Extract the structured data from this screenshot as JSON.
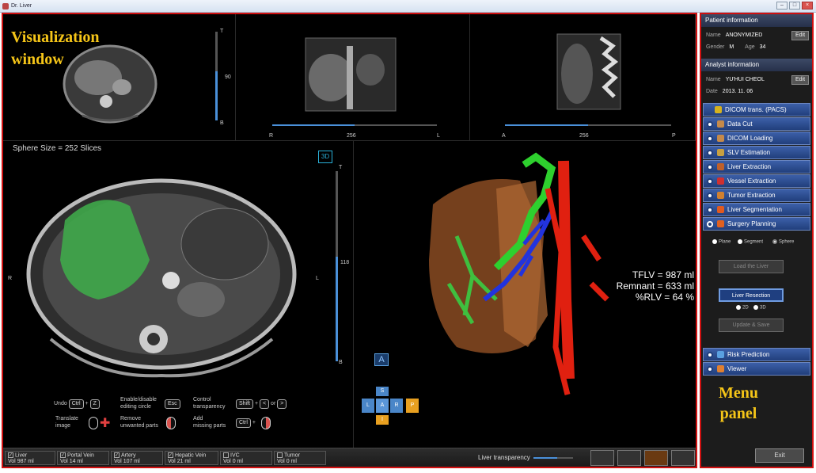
{
  "window": {
    "title": "Dr. Liver"
  },
  "overlay": {
    "viz_title_line1": "Visualization",
    "viz_title_line2": "window",
    "menu_title_line1": "Menu",
    "menu_title_line2": "panel"
  },
  "axial_small": {
    "top": "T",
    "bottom": "B",
    "value": "90"
  },
  "coronal": {
    "left": "R",
    "right": "L",
    "value": "256"
  },
  "sagittal": {
    "left": "A",
    "right": "P",
    "value": "256"
  },
  "main_axial": {
    "sphere_size": "Sphere Size = 252 Slices",
    "left": "R",
    "right": "L",
    "top": "T",
    "bottom": "B",
    "value": "118",
    "badge_3d": "3D"
  },
  "stats": {
    "tflv": "TFLV = 987 ml",
    "remnant": "Remnant = 633 ml",
    "rlv": "%RLV = 64 %"
  },
  "orientation": {
    "a_top": "A",
    "s": "S",
    "l": "L",
    "a": "A",
    "r": "R",
    "p": "P",
    "i": "I"
  },
  "hints": {
    "undo": "Undo",
    "undo_key1": "Ctrl",
    "undo_key2": "Z",
    "translate": "Translate\nimage",
    "enable": "Enable/disable\nediting circle",
    "enable_key": "Esc",
    "remove": "Remove\nunwanted parts",
    "control": "Control\ntransparency",
    "control_key1": "Shift",
    "control_key2": "<",
    "control_or": "or",
    "control_key3": ">",
    "add": "Add\nmissing parts",
    "add_key": "Ctrl"
  },
  "structures": [
    {
      "name": "Liver",
      "vol_label": "Vol",
      "vol": "987 ml"
    },
    {
      "name": "Portal Vein",
      "vol_label": "Vol",
      "vol": "14 ml"
    },
    {
      "name": "Artery",
      "vol_label": "Vol",
      "vol": "107 ml"
    },
    {
      "name": "Hepatic Vein",
      "vol_label": "Vol",
      "vol": "21 ml"
    },
    {
      "name": "IVC",
      "vol_label": "Vol",
      "vol": "0 ml"
    },
    {
      "name": "Tumor",
      "vol_label": "Vol",
      "vol": "0 ml"
    }
  ],
  "bottom": {
    "liver_transparency": "Liver transparency"
  },
  "patient": {
    "header": "Patient information",
    "name_label": "Name",
    "name": "ANONYMIZED",
    "edit": "Edit",
    "gender_label": "Gender",
    "gender": "M",
    "age_label": "Age",
    "age": "34"
  },
  "analyst": {
    "header": "Analyst information",
    "name_label": "Name",
    "name": "YU'HUI CHEOL",
    "edit": "Edit",
    "date_label": "Date",
    "date": "2013. 11. 06"
  },
  "steps": [
    {
      "label": "DICOM trans. (PACS)",
      "color": "#d6b21e"
    },
    {
      "label": "Data Cut",
      "color": "#c58a4a"
    },
    {
      "label": "DICOM Loading",
      "color": "#c58a4a"
    },
    {
      "label": "SLV Estimation",
      "color": "#c8a040"
    },
    {
      "label": "Liver Extraction",
      "color": "#c0602a"
    },
    {
      "label": "Vessel Extraction",
      "color": "#d03030"
    },
    {
      "label": "Tumor Extraction",
      "color": "#d08030"
    },
    {
      "label": "Liver Segmentation",
      "color": "#e05a20"
    },
    {
      "label": "Surgery Planning",
      "color": "#e06020"
    }
  ],
  "planning": {
    "plane": "Plane",
    "segment": "Segment",
    "sphere": "Sphere",
    "load_liver": "Load the Liver",
    "liver_resection": "Liver Resection",
    "opt_2d": "2D",
    "opt_3d": "3D",
    "update_save": "Update & Save"
  },
  "steps_after": [
    {
      "label": "Risk Prediction",
      "color": "#5aa0e0"
    },
    {
      "label": "Viewer",
      "color": "#e08030"
    }
  ],
  "exit": "Exit"
}
